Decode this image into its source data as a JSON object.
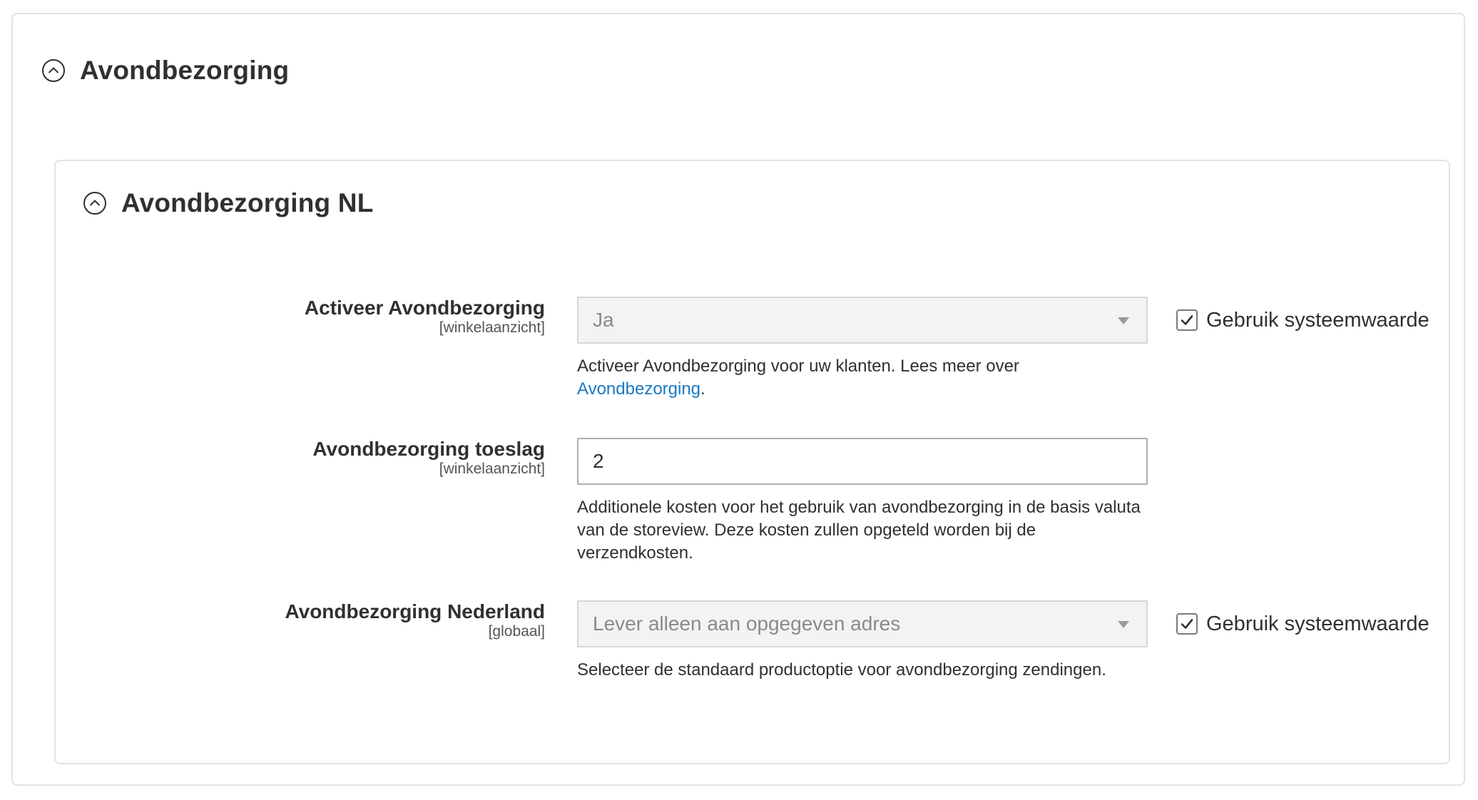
{
  "outer_section": {
    "title": "Avondbezorging",
    "icon": "collapse-up-icon"
  },
  "inner_section": {
    "title": "Avondbezorging NL",
    "icon": "collapse-up-icon"
  },
  "fields": [
    {
      "label": "Activeer Avondbezorging",
      "scope": "[winkelaanzicht]",
      "type": "select",
      "value": "Ja",
      "disabled": true,
      "note_text": "Activeer Avondbezorging voor uw klanten. Lees meer over",
      "note_link": "Avondbezorging",
      "note_suffix": ".",
      "use_default_checked": true,
      "use_default_label": "Gebruik systeemwaarde"
    },
    {
      "label": "Avondbezorging toeslag",
      "scope": "[winkelaanzicht]",
      "type": "input",
      "value": "2",
      "disabled": false,
      "note_text": "Additionele kosten voor het gebruik van avondbezorging in de basis valuta van de storeview. Deze kosten zullen opgeteld worden bij de verzendkosten."
    },
    {
      "label": "Avondbezorging Nederland",
      "scope": "[globaal]",
      "type": "select",
      "value": "Lever alleen aan opgegeven adres",
      "disabled": true,
      "note_text": "Selecteer de standaard productoptie voor avondbezorging zendingen.",
      "use_default_checked": true,
      "use_default_label": "Gebruik systeemwaarde"
    }
  ],
  "colors": {
    "link": "#1979c3",
    "border": "#e3e3e3",
    "disabled_bg": "#f3f3f3"
  }
}
